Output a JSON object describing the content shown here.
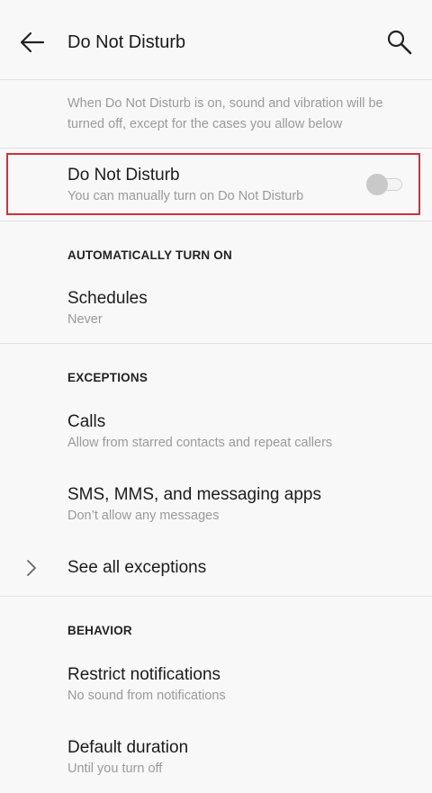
{
  "header": {
    "title": "Do Not Disturb",
    "back_icon": "arrow-back-icon",
    "search_icon": "search-icon"
  },
  "intro_text": "When Do Not Disturb is on, sound and vibration will be turned off, except for the cases you allow below",
  "dnd_toggle_row": {
    "title": "Do Not Disturb",
    "subtitle": "You can manually turn on Do Not Disturb",
    "toggle_state": "off"
  },
  "sections": {
    "auto": {
      "header": "AUTOMATICALLY TURN ON",
      "schedules_title": "Schedules",
      "schedules_subtitle": "Never"
    },
    "exceptions": {
      "header": "EXCEPTIONS",
      "calls_title": "Calls",
      "calls_subtitle": "Allow from starred contacts and repeat callers",
      "sms_title": "SMS, MMS, and messaging apps",
      "sms_subtitle": "Don’t allow any messages",
      "see_all": "See all exceptions"
    },
    "behavior": {
      "header": "BEHAVIOR",
      "restrict_title": "Restrict notifications",
      "restrict_subtitle": "No sound from notifications",
      "duration_title": "Default duration",
      "duration_subtitle": "Until you turn off"
    }
  },
  "colors": {
    "background": "#f8f8f8",
    "highlight": "#d0303c",
    "secondary_text": "#9a9a9a"
  }
}
